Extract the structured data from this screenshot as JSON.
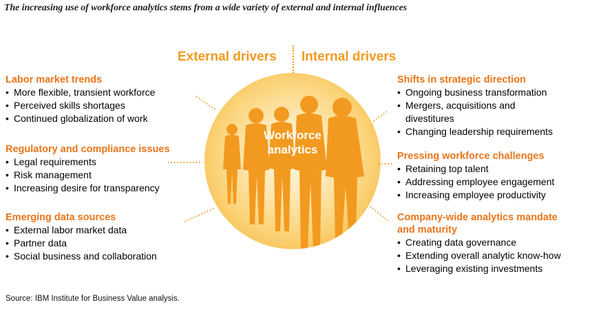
{
  "subtitle": "The increasing use of workforce analytics stems from a wide variety of external and internal influences",
  "external_heading": "External drivers",
  "internal_heading": "Internal drivers",
  "center_label_line1": "Workforce",
  "center_label_line2": "analytics",
  "colors": {
    "accent_orange": "#f29a1f",
    "title_orange": "#e8751a",
    "silhouette": "#f29a1f"
  },
  "external_groups": [
    {
      "title": "Labor market trends",
      "items": [
        "More flexible, transient workforce",
        "Perceived skills shortages",
        "Continued globalization of work"
      ]
    },
    {
      "title": "Regulatory and compliance issues",
      "items": [
        "Legal requirements",
        "Risk management",
        "Increasing desire for transparency"
      ]
    },
    {
      "title": "Emerging data sources",
      "items": [
        "External labor market data",
        "Partner data",
        "Social business and collaboration"
      ]
    }
  ],
  "internal_groups": [
    {
      "title": "Shifts in strategic direction",
      "items": [
        "Ongoing business transformation",
        "Mergers, acquisitions and divestitures",
        "Changing leadership requirements"
      ]
    },
    {
      "title": "Pressing workforce challenges",
      "items": [
        "Retaining top talent",
        "Addressing employee engagement",
        "Increasing employee productivity"
      ]
    },
    {
      "title": "Company-wide analytics mandate and maturity",
      "items": [
        "Creating data governance",
        "Extending overall analytic know-how",
        "Leveraging existing investments"
      ]
    }
  ],
  "source": "Source: IBM Institute for Business Value analysis."
}
